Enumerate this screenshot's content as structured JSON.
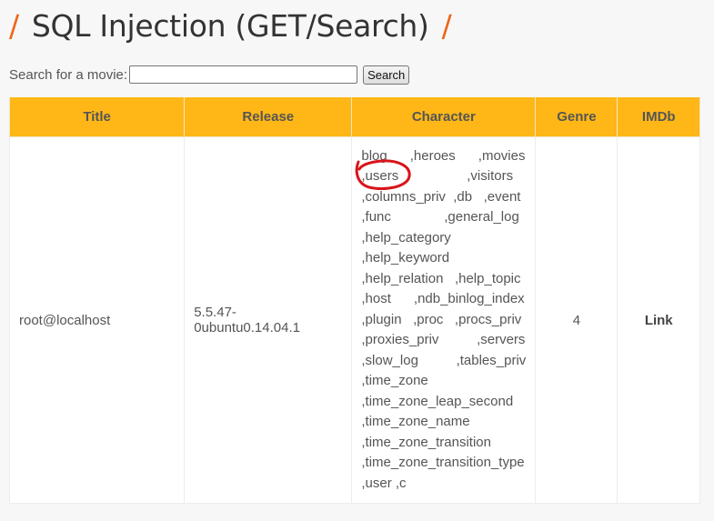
{
  "header": {
    "title": "SQL Injection (GET/Search)",
    "left_slash": "/",
    "right_slash": "/"
  },
  "search": {
    "label": "Search for a movie:",
    "value": "",
    "button_label": "Search"
  },
  "table": {
    "columns": [
      "Title",
      "Release",
      "Character",
      "Genre",
      "IMDb"
    ],
    "row": {
      "title": "root@localhost",
      "release": "5.5.47-0ubuntu0.14.04.1",
      "character": "blog      ,heroes      ,movies\n,users                  ,visitors\n,columns_priv  ,db   ,event\n,func              ,general_log\n,help_category\n,help_keyword\n,help_relation   ,help_topic\n,host      ,ndb_binlog_index\n,plugin   ,proc   ,procs_priv\n,proxies_priv          ,servers\n,slow_log          ,tables_priv\n,time_zone\n,time_zone_leap_second\n,time_zone_name\n,time_zone_transition\n,time_zone_transition_type\n,user ,c",
      "genre": "4",
      "imdb": "Link"
    }
  },
  "colors": {
    "accent": "#ee6519",
    "header_bg": "#ffb717",
    "annotation": "#d9141b"
  }
}
